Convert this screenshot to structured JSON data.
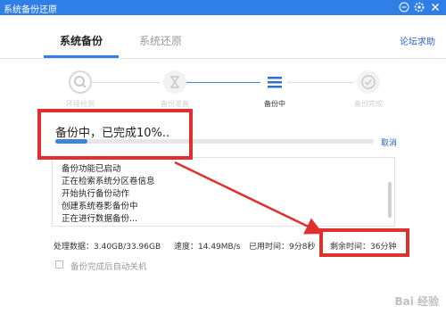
{
  "window": {
    "title": "系统备份还原",
    "accent": "#2f7fe6",
    "controls": [
      "minimize-icon",
      "settings-icon",
      "close-icon"
    ]
  },
  "tabs": [
    {
      "label": "系统备份",
      "active": true
    },
    {
      "label": "系统还原",
      "active": false
    }
  ],
  "forum_link": "论坛求助",
  "steps": [
    {
      "label": "环境检测",
      "icon": "search-icon",
      "state": "done"
    },
    {
      "label": "备份准备",
      "icon": "hourglass-icon",
      "state": "done"
    },
    {
      "label": "备份中",
      "icon": "list-icon",
      "state": "current"
    },
    {
      "label": "备份完成",
      "icon": "check-icon",
      "state": "pending"
    }
  ],
  "progress": {
    "text": "备份中，已完成10%..",
    "fraction": 0.1,
    "cancel_label": "取消"
  },
  "log": [
    "备份功能已启动",
    "正在检索系统分区卷信息",
    "开始执行备份动作",
    "创建系统卷影备份中",
    "正在进行数据备份..."
  ],
  "stats": {
    "data": "处理数据：3.40GB/33.96GB",
    "speed": "速度：14.49MB/s",
    "elapsed": "已用时间：9分8秒",
    "remaining": "剩余时间：36分钟"
  },
  "shutdown_option": {
    "label": "备份完成后自动关机",
    "checked": false
  },
  "annotations": {
    "highlight_color": "#e0302e"
  },
  "watermark": "Bai 经验"
}
